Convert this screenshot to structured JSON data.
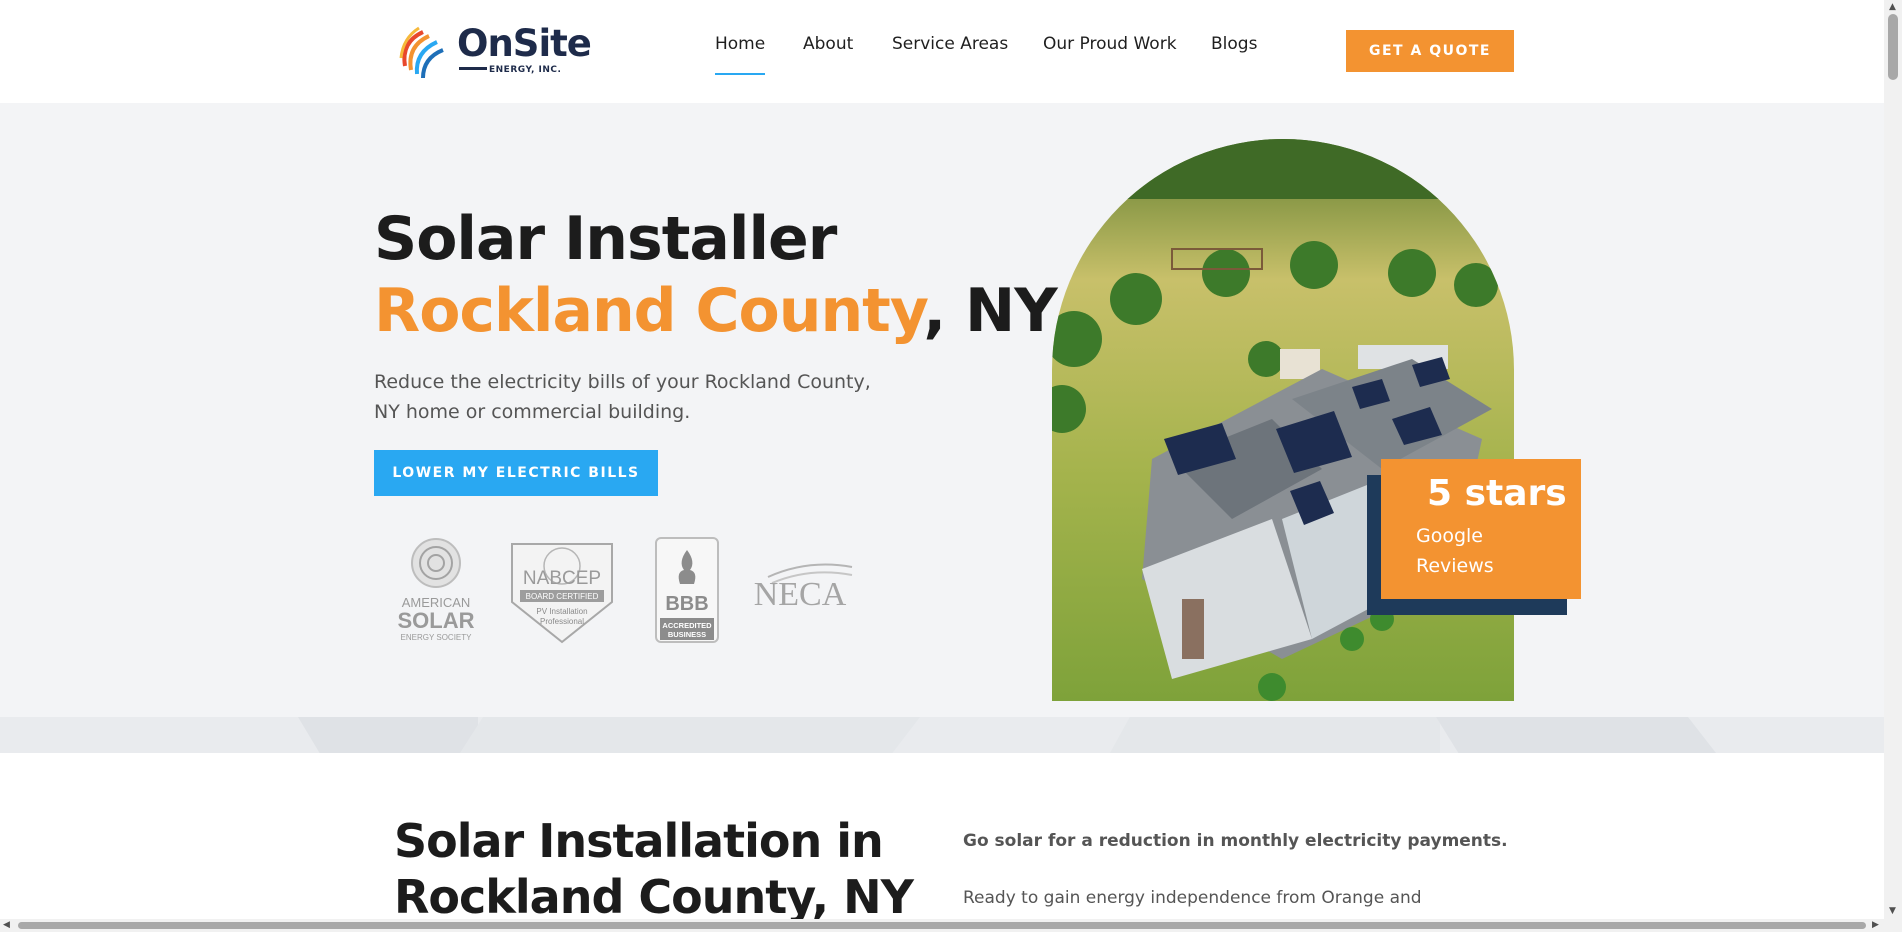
{
  "header": {
    "logo_text": "OnSite",
    "logo_sub": "ENERGY, INC.",
    "nav": [
      {
        "label": "Home"
      },
      {
        "label": "About"
      },
      {
        "label": "Service Areas"
      },
      {
        "label": "Our Proud Work"
      },
      {
        "label": "Blogs"
      }
    ],
    "quote_button": "GET A QUOTE"
  },
  "hero": {
    "title_line1": "Solar Installer",
    "title_highlight": "Rockland County",
    "title_suffix": ", NY",
    "description": "Reduce the electricity bills of your Rockland County, NY home or commercial building.",
    "cta": "LOWER MY ELECTRIC BILLS",
    "badges": {
      "ases": {
        "line1": "AMERICAN",
        "line2": "SOLAR",
        "line3": "ENERGY SOCIETY"
      },
      "nabcep": {
        "line1": "NABCEP",
        "line2": "BOARD CERTIFIED",
        "line3": "PV Installation",
        "line4": "Professional"
      },
      "bbb": {
        "line1": "BBB",
        "line2": "ACCREDITED",
        "line3": "BUSINESS"
      },
      "neca": {
        "line1": "NECA"
      }
    },
    "rating": {
      "title": "5 stars",
      "subtitle": "Google Reviews"
    }
  },
  "section2": {
    "title": "Solar Installation in Rockland County, NY",
    "lead": "Go solar for a reduction in monthly electricity payments.",
    "paragraph": "Ready to gain energy independence from Orange and Rockland"
  },
  "colors": {
    "accent_orange": "#f39331",
    "accent_blue": "#29a8f2",
    "navy": "#1e2b4a"
  }
}
